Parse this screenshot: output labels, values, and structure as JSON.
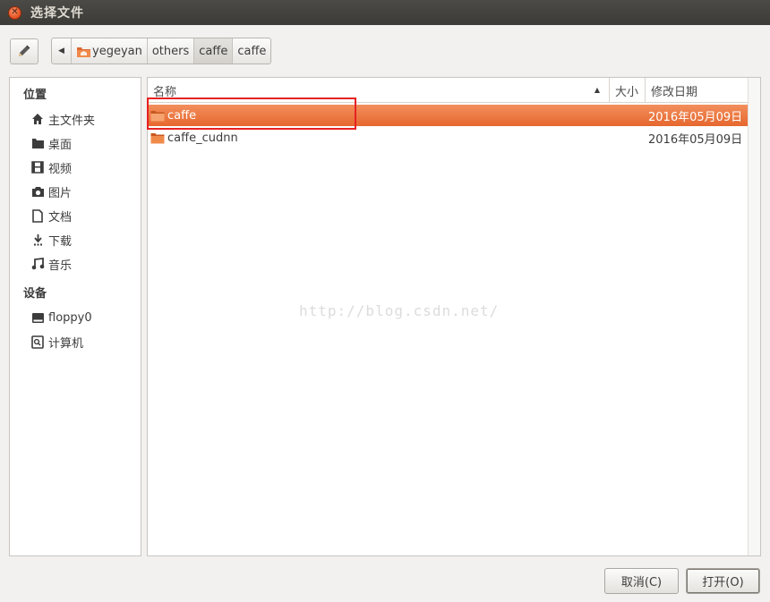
{
  "window": {
    "title": "选择文件"
  },
  "toolbar": {
    "path": [
      {
        "label": "yegeyan",
        "icon": "home-folder-icon"
      },
      {
        "label": "others"
      },
      {
        "label": "caffe",
        "active": true
      },
      {
        "label": "caffe"
      }
    ]
  },
  "sidebar": {
    "places_heading": "位置",
    "places": [
      {
        "label": "主文件夹",
        "icon": "home-icon"
      },
      {
        "label": "桌面",
        "icon": "desktop-icon"
      },
      {
        "label": "视频",
        "icon": "video-icon"
      },
      {
        "label": "图片",
        "icon": "camera-icon"
      },
      {
        "label": "文档",
        "icon": "document-icon"
      },
      {
        "label": "下载",
        "icon": "download-icon"
      },
      {
        "label": "音乐",
        "icon": "music-icon"
      }
    ],
    "devices_heading": "设备",
    "devices": [
      {
        "label": "floppy0",
        "icon": "drive-icon"
      },
      {
        "label": "计算机",
        "icon": "computer-icon"
      }
    ]
  },
  "filelist": {
    "columns": {
      "name": "名称",
      "size": "大小",
      "modified": "修改日期"
    },
    "rows": [
      {
        "name": "caffe",
        "size": "",
        "modified": "2016年05月09日",
        "selected": true
      },
      {
        "name": "caffe_cudnn",
        "size": "",
        "modified": "2016年05月09日",
        "selected": false
      }
    ]
  },
  "watermark": "http://blog.csdn.net/",
  "buttons": {
    "cancel": "取消(C)",
    "open": "打开(O)"
  },
  "colors": {
    "selection": "#e96f35",
    "highlight_box": "#e62222",
    "titlebar": "#3c3b37"
  }
}
